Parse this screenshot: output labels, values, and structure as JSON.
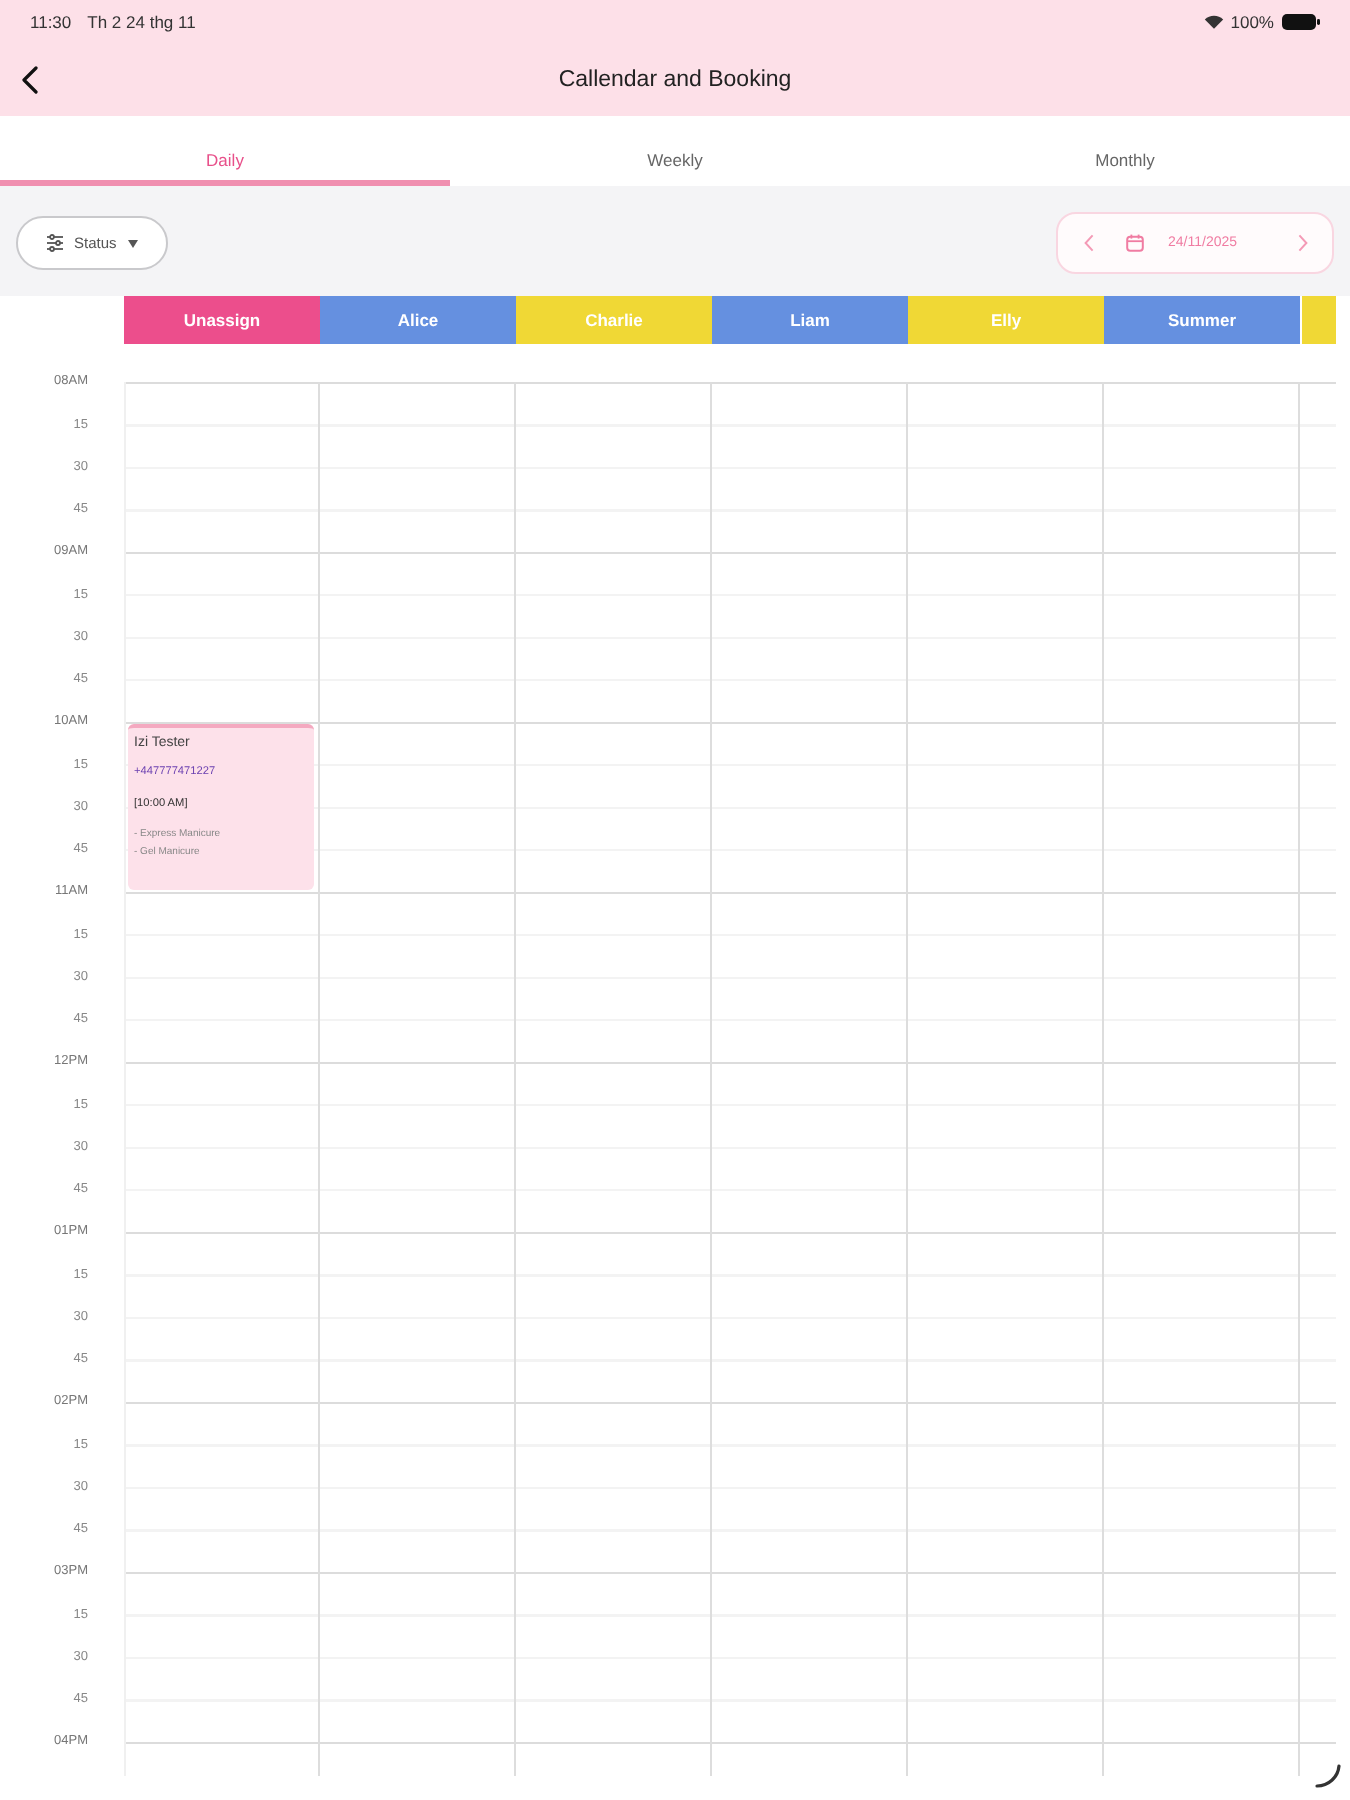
{
  "status_bar": {
    "time": "11:30",
    "date": "Th 2 24 thg 11",
    "battery": "100%"
  },
  "header": {
    "title": "Callendar and Booking"
  },
  "tabs": [
    {
      "label": "Daily",
      "selected": true
    },
    {
      "label": "Weekly",
      "selected": false
    },
    {
      "label": "Monthly",
      "selected": false
    }
  ],
  "toolbar": {
    "filter": {
      "label": "Status"
    },
    "date_picker": {
      "value": "24/11/2025"
    }
  },
  "staff": [
    {
      "name": "Unassign",
      "color": "#ec4e8c",
      "appointments": [
        {
          "customer": "Izi Tester",
          "phone": "+447777471227",
          "time": "[10:00 AM]",
          "services": [
            "- Express Manicure",
            "- Gel Manicure"
          ]
        }
      ]
    },
    {
      "name": "Alice",
      "color": "#6590e0"
    },
    {
      "name": "Charlie",
      "color": "#f0d835"
    },
    {
      "name": "Liam",
      "color": "#6590e0"
    },
    {
      "name": "Elly",
      "color": "#f0d835"
    },
    {
      "name": "Summer",
      "color": "#6590e0"
    },
    {
      "color": "#f0d835"
    }
  ],
  "time_slots": [
    "08AM",
    "15",
    "30",
    "45",
    "09AM",
    "15",
    "30",
    "45",
    "10AM",
    "15",
    "30",
    "45",
    "11AM",
    "15",
    "30",
    "45",
    "12PM",
    "15",
    "30",
    "45",
    "01PM",
    "15",
    "30",
    "45",
    "02PM",
    "15",
    "30",
    "45",
    "03PM",
    "15",
    "30",
    "45",
    "04PM"
  ]
}
